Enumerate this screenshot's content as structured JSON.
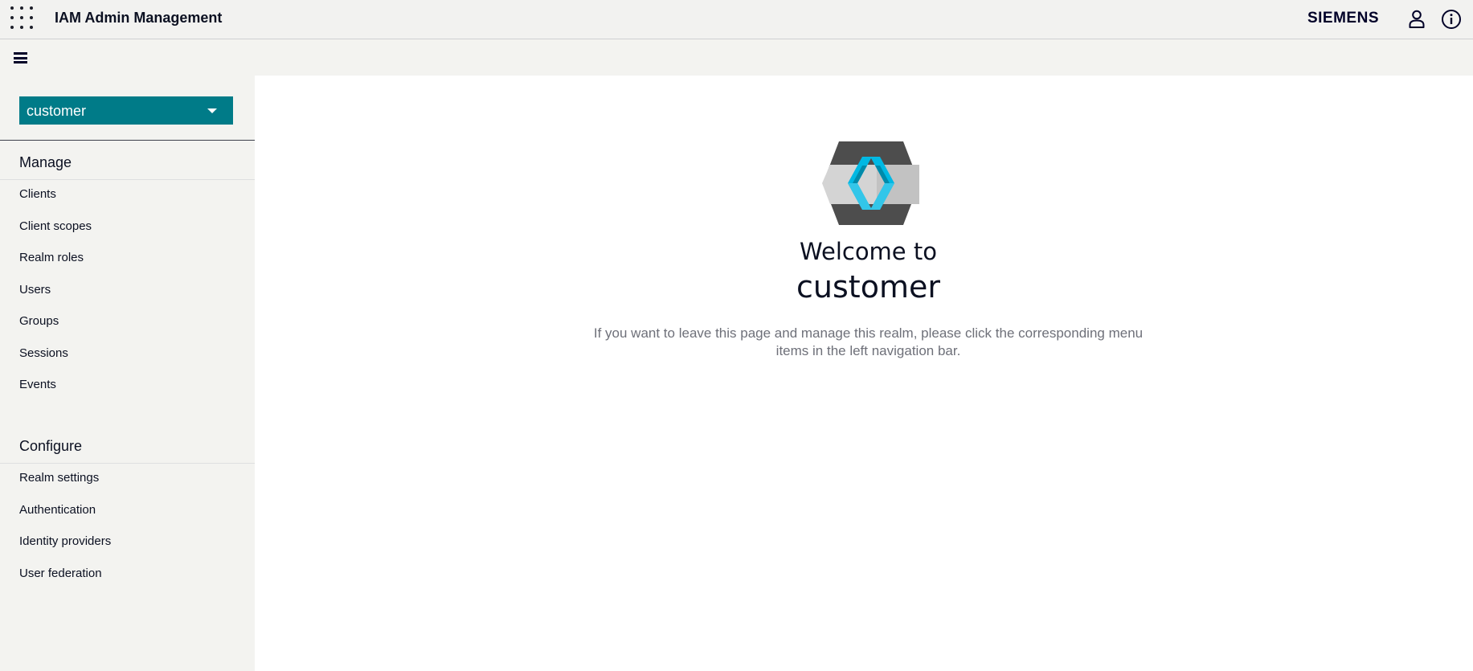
{
  "header": {
    "app_title": "IAM Admin Management",
    "brand": "SIEMENS",
    "launcher_icon": "app-grid-icon",
    "user_icon": "user-icon",
    "info_icon": "info-icon"
  },
  "toolbar": {
    "menu_icon": "hamburger-icon"
  },
  "sidebar": {
    "realm_selector": {
      "value": "customer",
      "color": "#007b88"
    },
    "sections": [
      {
        "title": "Manage",
        "items": [
          "Clients",
          "Client scopes",
          "Realm roles",
          "Users",
          "Groups",
          "Sessions",
          "Events"
        ]
      },
      {
        "title": "Configure",
        "items": [
          "Realm settings",
          "Authentication",
          "Identity providers",
          "User federation"
        ]
      }
    ]
  },
  "main": {
    "logo_icon": "keycloak-logo",
    "welcome_title": "Welcome to",
    "realm_name": "customer",
    "description": "If you want to leave this page and manage this realm, please click the corresponding menu items in the left navigation bar."
  }
}
